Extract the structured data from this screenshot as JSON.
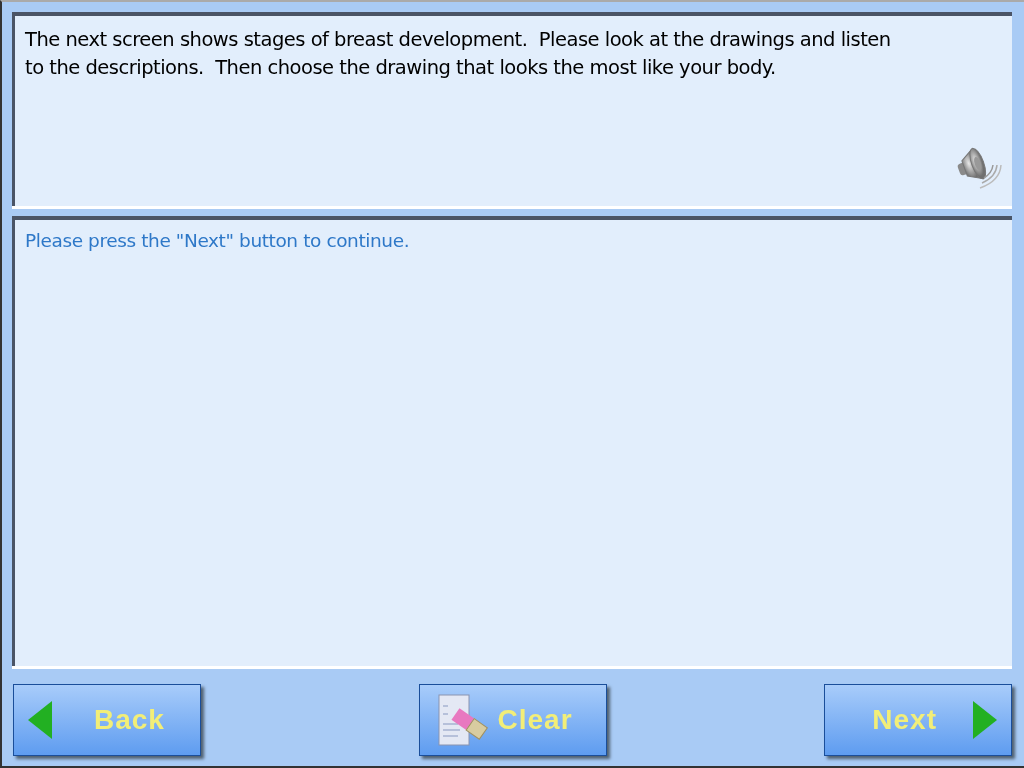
{
  "question_panel": {
    "text": "The next screen shows stages of breast development.  Please look at the drawings and listen to the descriptions.  Then choose the drawing that looks the most like your body."
  },
  "answer_panel": {
    "text": "Please press the \"Next\" button to continue."
  },
  "buttons": [
    {
      "kind": "back",
      "label": "Back"
    },
    {
      "kind": "clear",
      "label": "Clear"
    },
    {
      "kind": "next",
      "label": "Next"
    }
  ]
}
